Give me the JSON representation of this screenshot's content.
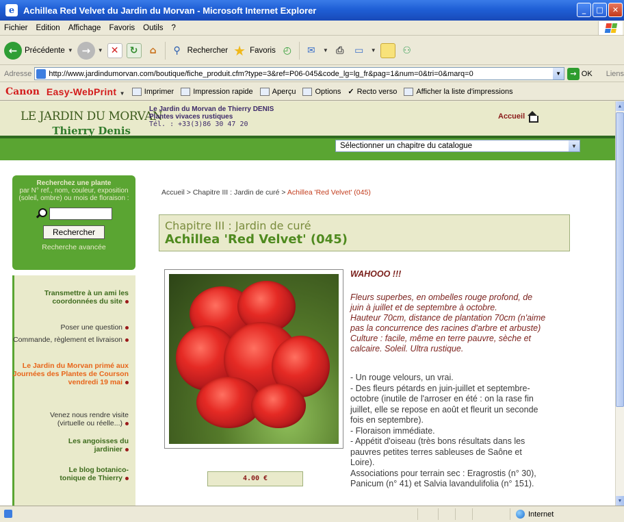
{
  "window": {
    "title": "Achillea Red Velvet du Jardin du Morvan - Microsoft Internet Explorer"
  },
  "menu": [
    "Fichier",
    "Edition",
    "Affichage",
    "Favoris",
    "Outils",
    "?"
  ],
  "toolbar": {
    "back": "Précédente",
    "search": "Rechercher",
    "favorites": "Favoris"
  },
  "address": {
    "label": "Adresse",
    "url": "http://www.jardindumorvan.com/boutique/fiche_produit.cfm?type=3&ref=P06-045&code_lg=lg_fr&pag=1&num=0&tri=0&marq=0",
    "go": "OK",
    "links": "Liens"
  },
  "canon": {
    "brand": "Canon",
    "product": "Easy-WebPrint",
    "print": "Imprimer",
    "quick": "Impression rapide",
    "preview": "Aperçu",
    "options": "Options",
    "duplex": "Recto verso",
    "list": "Afficher la liste d'impressions"
  },
  "site": {
    "logo_line1": "LE JARDIN DU MORVAN",
    "logo_line2": "Thierry Denis",
    "company_name": "Le Jardin du Morvan de Thierry DENIS",
    "company_tagline": "Plantes vivaces rustiques",
    "phone": "Tél. : +33(3)86 30 47 20",
    "home_link": "Accueil",
    "chapter_select": "Sélectionner un chapitre du catalogue"
  },
  "sidebar": {
    "search_title": "Recherchez une plante",
    "search_hint": "par N° ref., nom, couleur, exposition (soleil, ombre) ou mois de floraison :",
    "search_button": "Rechercher",
    "advanced": "Recherche avancée",
    "nav": [
      {
        "label": "Transmettre à un ami les coordonnées du site"
      },
      {
        "label": "Poser une question"
      },
      {
        "label": "Commande, règlement et livraison"
      },
      {
        "label": "Le Jardin du Morvan primé aux Journées des Plantes de Courson vendredi 19 mai"
      },
      {
        "label": "Venez nous rendre visite (virtuelle ou réelle...)"
      },
      {
        "label": "Les angoisses du jardinier"
      },
      {
        "label": "Le blog botanico-tonique de Thierry"
      }
    ]
  },
  "breadcrumb": {
    "home": "Accueil",
    "chapter": "Chapitre III : Jardin de curé",
    "current": "Achillea 'Red Velvet' (045)",
    "sep": ">"
  },
  "product": {
    "chapter": "Chapitre III : Jardin de curé",
    "title": "Achillea 'Red Velvet' (045)",
    "price": "4.00 €",
    "headline": "WAHOOO !!!",
    "description": [
      "Fleurs superbes, en ombelles rouge profond, de",
      "juin à juillet et de septembre à octobre.",
      "Hauteur 70cm, distance de plantation 70cm (n'aime",
      "pas la concurrence des racines d'arbre et arbuste)",
      "Culture : facile, même en terre pauvre, sèche et",
      "calcaire. Soleil. Ultra rustique."
    ],
    "details": [
      "- Un rouge velours, un vrai.",
      "- Des fleurs pétards en juin-juillet et septembre-",
      "octobre (inutile de l'arroser en été : on la rase fin",
      "juillet, elle se repose en août et fleurit un seconde",
      "fois en septembre).",
      "- Floraison immédiate.",
      "- Appétit d'oiseau (très bons résultats dans les",
      "pauvres petites terres sableuses de Saône et",
      "Loire).",
      "Associations pour terrain sec : Eragrostis (n° 30),",
      "Panicum (n° 41) et Salvia lavandulifolia (n° 151)."
    ]
  },
  "status": {
    "zone": "Internet"
  },
  "colors": {
    "site_green": "#5aa532",
    "site_cream": "#e9eacb",
    "accent_red": "#8a1a1a",
    "xp_blue": "#1f5fd6"
  }
}
